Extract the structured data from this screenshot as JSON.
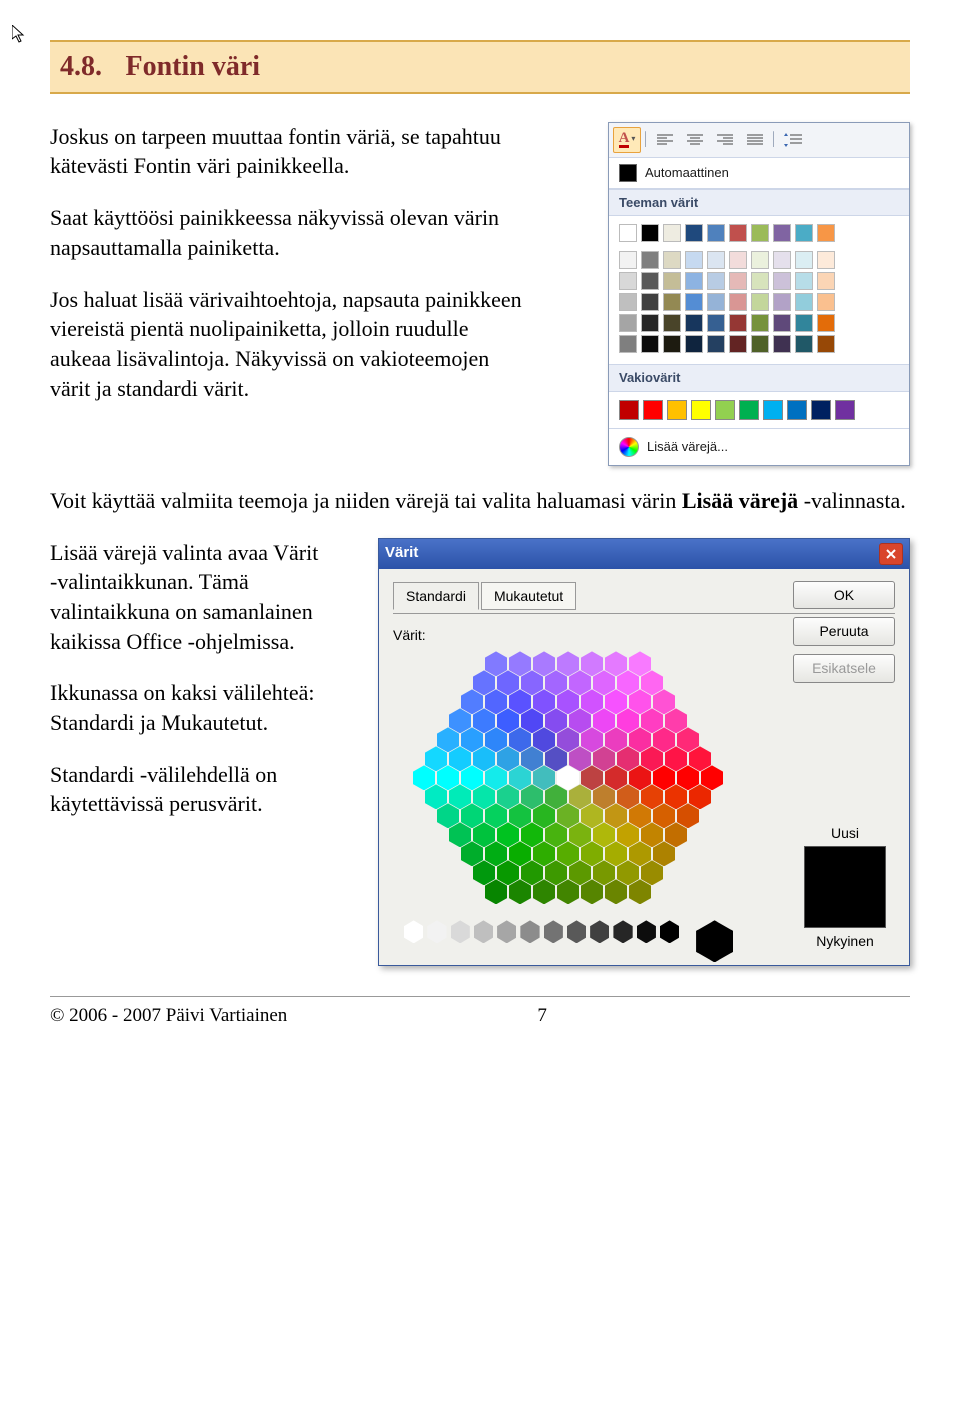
{
  "heading": {
    "number": "4.8.",
    "title": "Fontin väri"
  },
  "paragraphs": {
    "p1": "Joskus on tarpeen muuttaa fontin väriä, se tapahtuu kätevästi Fontin väri painikkeella.",
    "p2": "Saat käyttöösi painikkeessa näkyvissä olevan värin napsauttamalla painiketta.",
    "p3": "Jos haluat lisää värivaihtoehtoja, napsauta painikkeen viereistä pientä nuolipainiketta, jolloin ruudulle aukeaa lisävalintoja. Näkyvissä on vakioteemojen värit ja standardi värit.",
    "p4_a": "Voit käyttää valmiita teemoja ja niiden värejä tai valita haluamasi värin ",
    "p4_b": "Lisää värejä",
    "p4_c": " -valinnasta.",
    "p5": "Lisää värejä valinta avaa Värit -valintaikkunan. Tämä valintaikkuna on samanlainen kaikissa Office -ohjelmissa.",
    "p6": "Ikkunassa on kaksi välilehteä: Standardi ja Mukautetut.",
    "p7": "Standardi -välilehdellä on käytettävissä perusvärit."
  },
  "dropdown": {
    "auto_label": "Automaattinen",
    "section_theme": "Teeman värit",
    "section_standard": "Vakiovärit",
    "more_colors": "Lisää värejä...",
    "theme_row0": [
      "#ffffff",
      "#000000",
      "#eeece1",
      "#1f497d",
      "#4f81bd",
      "#c0504d",
      "#9bbb59",
      "#8064a2",
      "#4bacc6",
      "#f79646"
    ],
    "theme_shades": [
      [
        "#f2f2f2",
        "#7f7f7f",
        "#ddd9c3",
        "#c6d9f0",
        "#dbe5f1",
        "#f2dcdb",
        "#ebf1dd",
        "#e5e0ec",
        "#dbeef3",
        "#fdeada"
      ],
      [
        "#d8d8d8",
        "#595959",
        "#c4bd97",
        "#8db3e2",
        "#b8cce4",
        "#e5b9b7",
        "#d7e3bc",
        "#ccc1d9",
        "#b7dde8",
        "#fbd5b5"
      ],
      [
        "#bfbfbf",
        "#3f3f3f",
        "#938953",
        "#548dd4",
        "#95b3d7",
        "#d99694",
        "#c3d69b",
        "#b2a2c7",
        "#92cddc",
        "#fac08f"
      ],
      [
        "#a5a5a5",
        "#262626",
        "#494429",
        "#17365d",
        "#366092",
        "#953734",
        "#76923c",
        "#5f497a",
        "#31859b",
        "#e36c09"
      ],
      [
        "#7f7f7f",
        "#0c0c0c",
        "#1d1b10",
        "#0f243e",
        "#244061",
        "#632423",
        "#4f6128",
        "#3f3151",
        "#205867",
        "#974806"
      ]
    ],
    "standard_colors": [
      "#c00000",
      "#ff0000",
      "#ffc000",
      "#ffff00",
      "#92d050",
      "#00b050",
      "#00b0f0",
      "#0070c0",
      "#002060",
      "#7030a0"
    ]
  },
  "dialog": {
    "title": "Värit",
    "tab_standard": "Standardi",
    "tab_custom": "Mukautetut",
    "btn_ok": "OK",
    "btn_cancel": "Peruuta",
    "btn_preview": "Esikatsele",
    "label_colors": "Värit:",
    "label_new": "Uusi",
    "label_current": "Nykyinen"
  },
  "footer": {
    "copyright": "© 2006 - 2007 Päivi Vartiainen",
    "page": "7"
  },
  "chart_data": null
}
